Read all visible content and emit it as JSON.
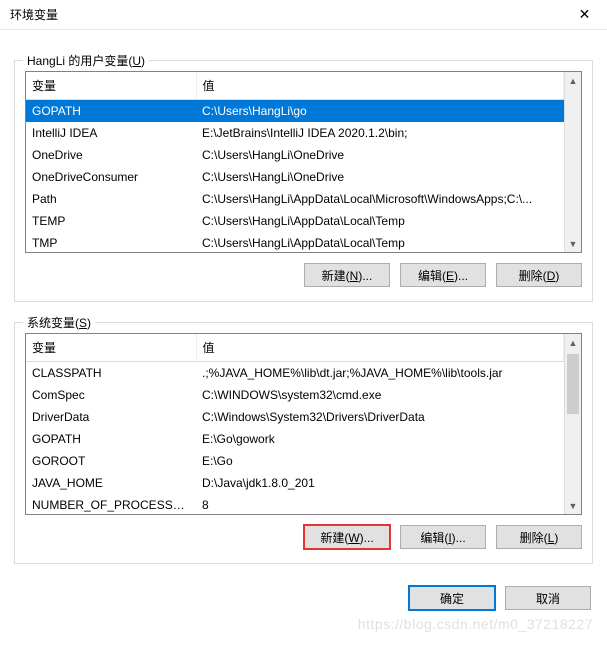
{
  "window": {
    "title": "环境变量",
    "close_glyph": "✕"
  },
  "user_vars": {
    "group_label_prefix": "HangLi 的用户变量(",
    "group_label_ul": "U",
    "group_label_suffix": ")",
    "headers": {
      "name": "变量",
      "value": "值"
    },
    "rows": [
      {
        "name": "GOPATH",
        "value": "C:\\Users\\HangLi\\go",
        "selected": true
      },
      {
        "name": "IntelliJ IDEA",
        "value": "E:\\JetBrains\\IntelliJ IDEA 2020.1.2\\bin;",
        "selected": false
      },
      {
        "name": "OneDrive",
        "value": "C:\\Users\\HangLi\\OneDrive",
        "selected": false
      },
      {
        "name": "OneDriveConsumer",
        "value": "C:\\Users\\HangLi\\OneDrive",
        "selected": false
      },
      {
        "name": "Path",
        "value": "C:\\Users\\HangLi\\AppData\\Local\\Microsoft\\WindowsApps;C:\\...",
        "selected": false
      },
      {
        "name": "TEMP",
        "value": "C:\\Users\\HangLi\\AppData\\Local\\Temp",
        "selected": false
      },
      {
        "name": "TMP",
        "value": "C:\\Users\\HangLi\\AppData\\Local\\Temp",
        "selected": false
      }
    ],
    "buttons": {
      "new_prefix": "新建(",
      "new_ul": "N",
      "new_suffix": ")...",
      "edit_prefix": "编辑(",
      "edit_ul": "E",
      "edit_suffix": ")...",
      "del_prefix": "删除(",
      "del_ul": "D",
      "del_suffix": ")"
    }
  },
  "sys_vars": {
    "group_label_prefix": "系统变量(",
    "group_label_ul": "S",
    "group_label_suffix": ")",
    "headers": {
      "name": "变量",
      "value": "值"
    },
    "rows": [
      {
        "name": "CLASSPATH",
        "value": ".;%JAVA_HOME%\\lib\\dt.jar;%JAVA_HOME%\\lib\\tools.jar"
      },
      {
        "name": "ComSpec",
        "value": "C:\\WINDOWS\\system32\\cmd.exe"
      },
      {
        "name": "DriverData",
        "value": "C:\\Windows\\System32\\Drivers\\DriverData"
      },
      {
        "name": "GOPATH",
        "value": "E:\\Go\\gowork"
      },
      {
        "name": "GOROOT",
        "value": "E:\\Go"
      },
      {
        "name": "JAVA_HOME",
        "value": "D:\\Java\\jdk1.8.0_201"
      },
      {
        "name": "NUMBER_OF_PROCESSORS",
        "value": "8"
      }
    ],
    "buttons": {
      "new_prefix": "新建(",
      "new_ul": "W",
      "new_suffix": ")...",
      "edit_prefix": "编辑(",
      "edit_ul": "I",
      "edit_suffix": ")...",
      "del_prefix": "删除(",
      "del_ul": "L",
      "del_suffix": ")"
    }
  },
  "dialog_buttons": {
    "ok": "确定",
    "cancel": "取消"
  },
  "watermark": "https://blog.csdn.net/m0_37218227"
}
